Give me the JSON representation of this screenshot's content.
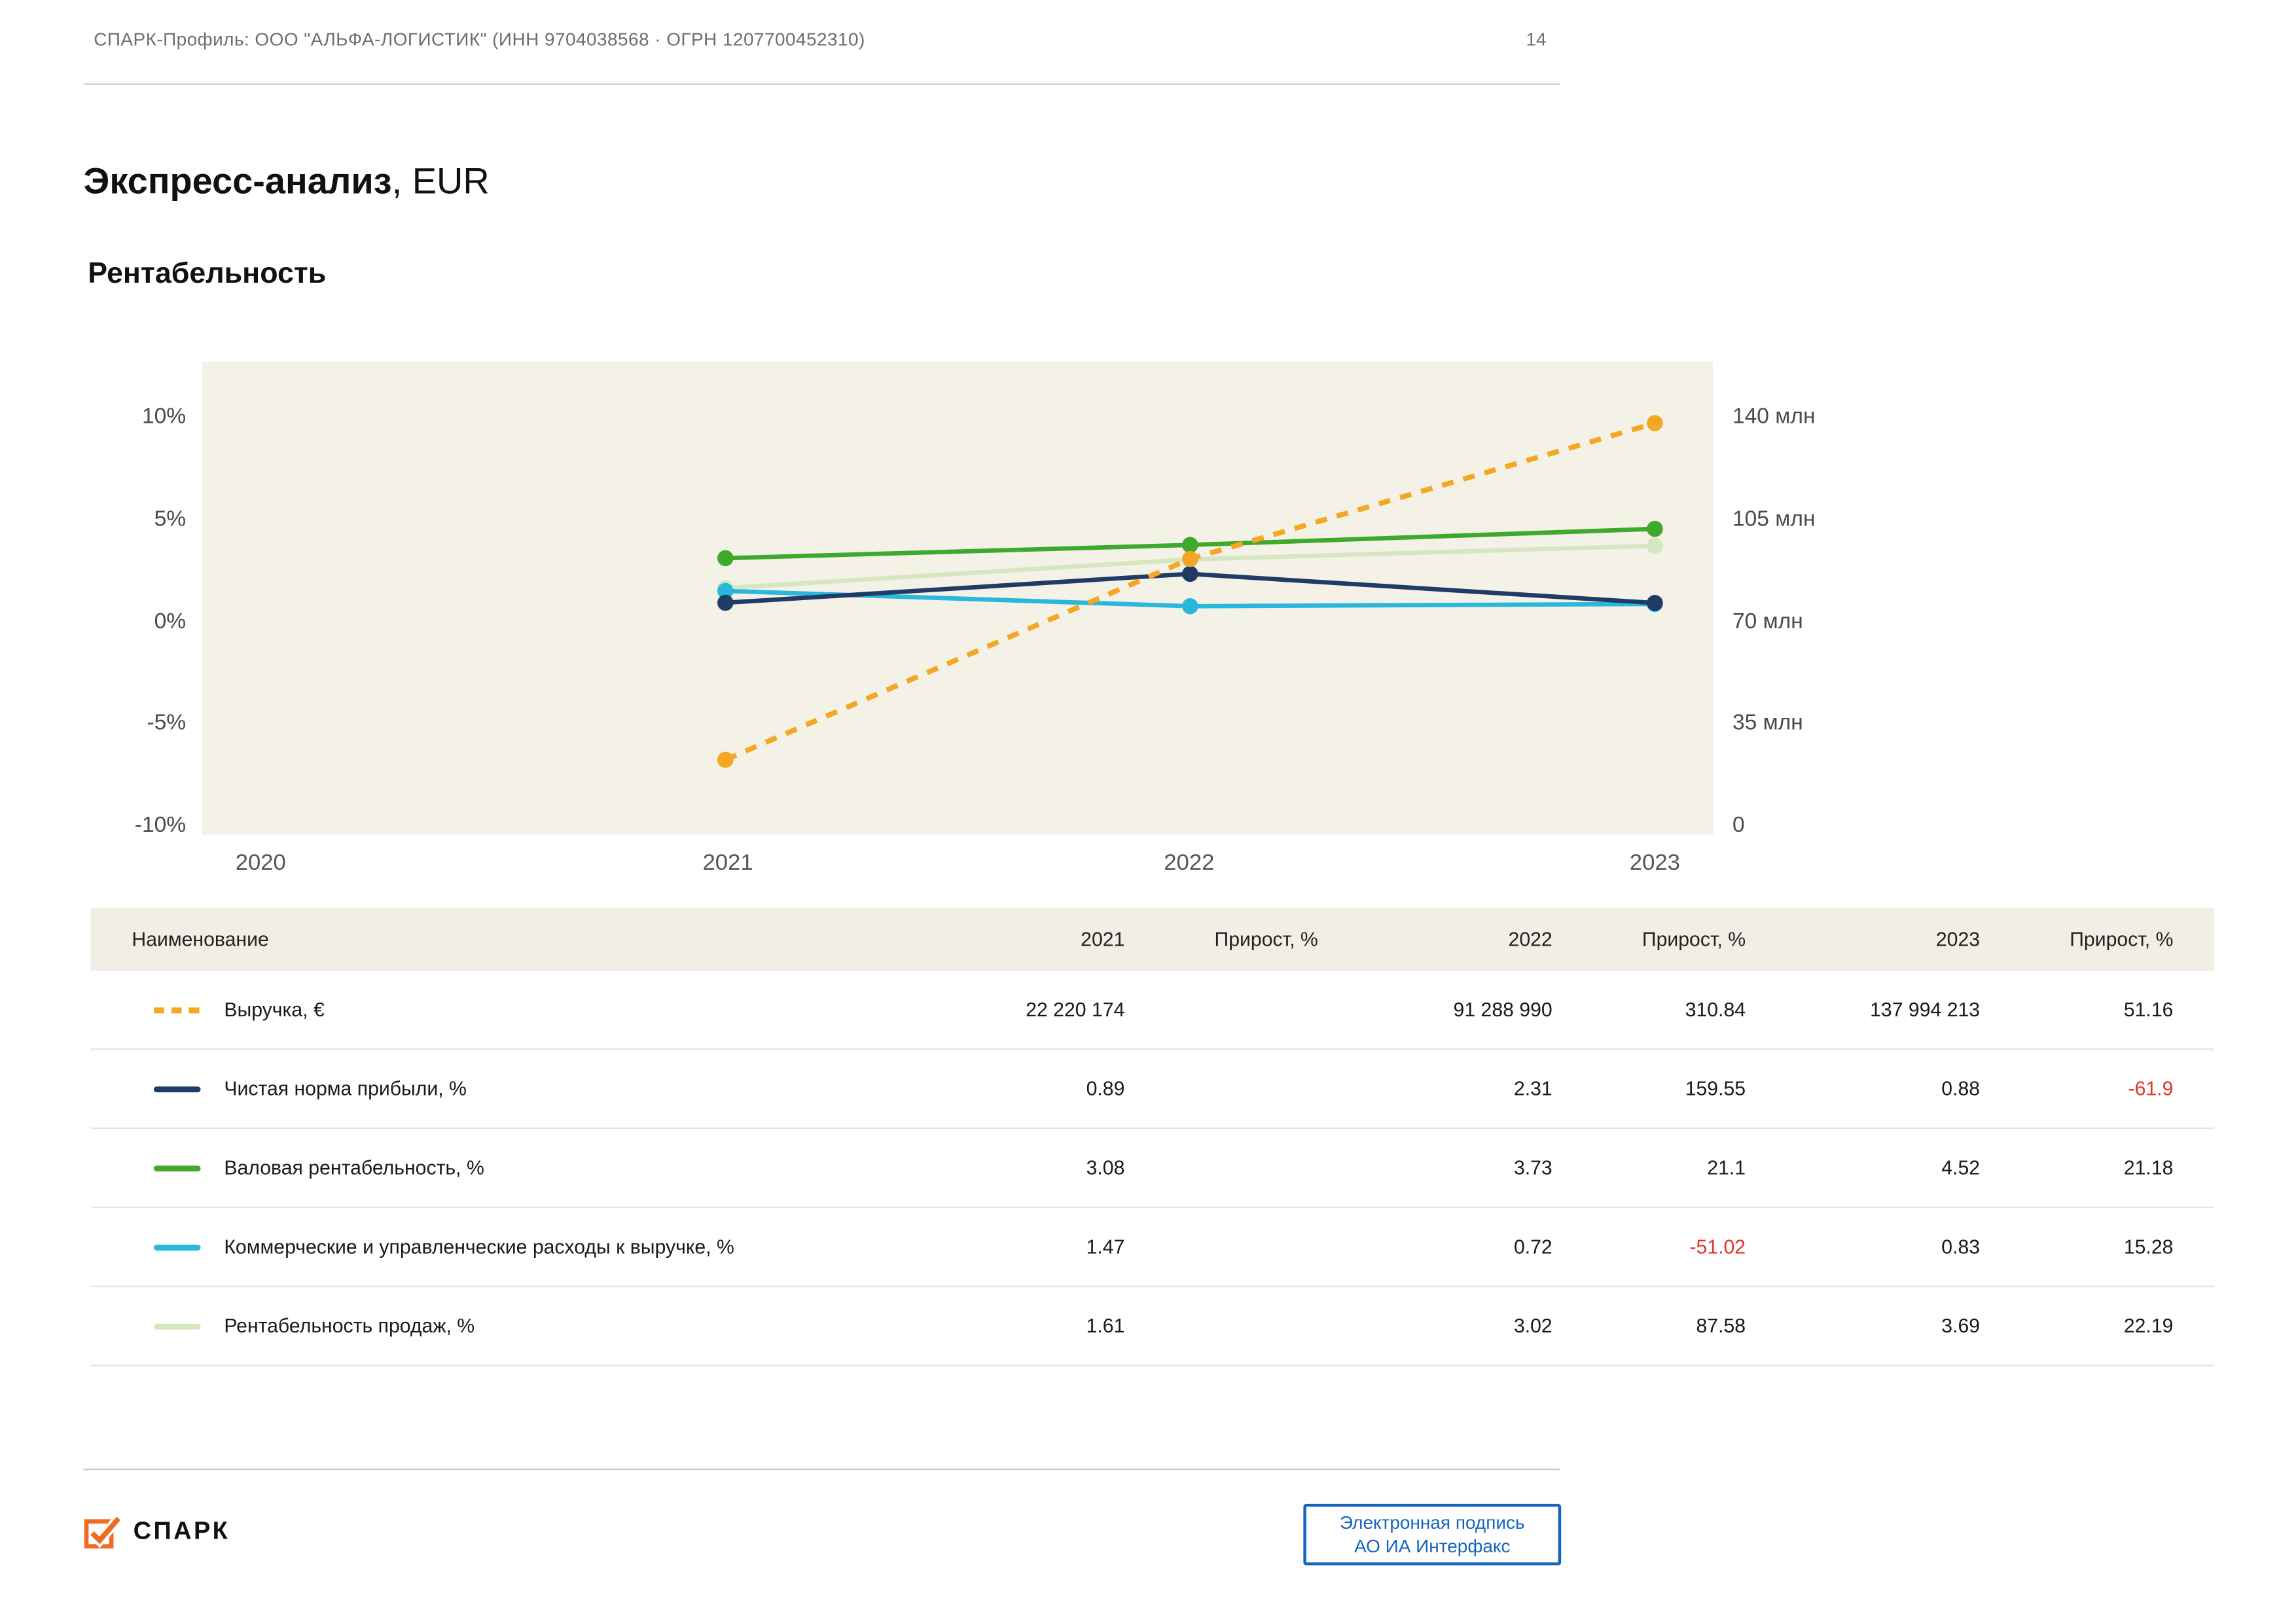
{
  "header": {
    "profile": "СПАРК-Профиль: ООО \"АЛЬФА-ЛОГИСТИК\" (ИНН 9704038568 · ОГРН 1207700452310)",
    "page_number": "14"
  },
  "title": {
    "main": "Экспресс-анализ",
    "suffix": ", EUR"
  },
  "section_title": "Рентабельность",
  "chart_data": {
    "type": "line",
    "title": "Рентабельность",
    "x_ticks": [
      "2020",
      "2021",
      "2022",
      "2023"
    ],
    "years": [
      2021,
      2022,
      2023
    ],
    "left_axis": {
      "min": -10,
      "max": 10,
      "unit": "%",
      "ticks": [
        "10%",
        "5%",
        "0%",
        "-5%",
        "-10%"
      ]
    },
    "right_axis": {
      "min": 0,
      "max": 140000000,
      "unit": "EUR",
      "ticks": [
        "140 млн",
        "105 млн",
        "70 млн",
        "35 млн",
        "0"
      ]
    },
    "grid": false,
    "legend_position": "table-below",
    "series": [
      {
        "name": "Рентабельность продаж, %",
        "axis": "left",
        "color": "#d5e6c0",
        "dash": false,
        "values": [
          1.61,
          3.02,
          3.69
        ]
      },
      {
        "name": "Коммерческие и управленческие расходы к выручке, %",
        "axis": "left",
        "color": "#29b8dc",
        "dash": false,
        "values": [
          1.47,
          0.72,
          0.83
        ]
      },
      {
        "name": "Чистая норма прибыли, %",
        "axis": "left",
        "color": "#1f3b66",
        "dash": false,
        "values": [
          0.89,
          2.31,
          0.88
        ]
      },
      {
        "name": "Валовая рентабельность, %",
        "axis": "left",
        "color": "#3fa92c",
        "dash": false,
        "values": [
          3.08,
          3.73,
          4.52
        ]
      },
      {
        "name": "Выручка, €",
        "axis": "right",
        "color": "#f5a623",
        "dash": true,
        "values": [
          22220174,
          91288990,
          137994213
        ]
      }
    ]
  },
  "table": {
    "headers": [
      "Наименование",
      "2021",
      "Прирост, %",
      "2022",
      "Прирост, %",
      "2023",
      "Прирост, %"
    ],
    "rows": [
      {
        "name": "Выручка, €",
        "values": [
          "22 220 174",
          "",
          "91 288 990",
          "310.84",
          "137 994 213",
          "51.16"
        ]
      },
      {
        "name": "Чистая норма прибыли, %",
        "values": [
          "0.89",
          "",
          "2.31",
          "159.55",
          "0.88",
          "-61.9"
        ]
      },
      {
        "name": "Валовая рентабельность, %",
        "values": [
          "3.08",
          "",
          "3.73",
          "21.1",
          "4.52",
          "21.18"
        ]
      },
      {
        "name": "Коммерческие и управленческие расходы к выручке, %",
        "values": [
          "1.47",
          "",
          "0.72",
          "-51.02",
          "0.83",
          "15.28"
        ]
      },
      {
        "name": "Рентабельность продаж, %",
        "values": [
          "1.61",
          "",
          "3.02",
          "87.58",
          "3.69",
          "22.19"
        ]
      }
    ]
  },
  "footer": {
    "logo_text": "СПАРК",
    "signature_line1": "Электронная подпись",
    "signature_line2": "АО ИА Интерфакс"
  },
  "colors": {
    "accent_orange": "#f26a21",
    "chart_bg": "#f4f1e7",
    "table_header_bg": "#f1efe5",
    "link_blue": "#1565c0",
    "negative_red": "#e0362b"
  }
}
